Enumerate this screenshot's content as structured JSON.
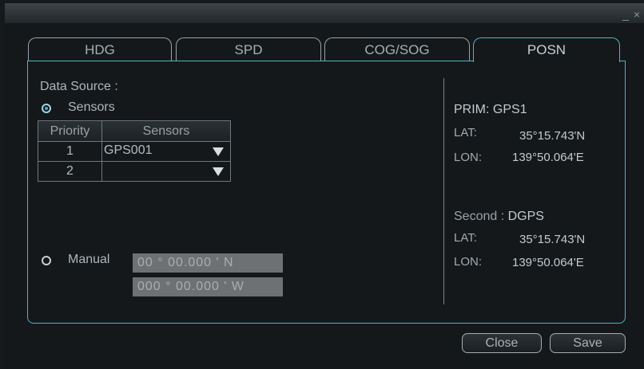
{
  "window": {
    "controls": "_ ×"
  },
  "tabs": [
    {
      "label": "HDG",
      "active": false
    },
    {
      "label": "SPD",
      "active": false
    },
    {
      "label": "COG/SOG",
      "active": false
    },
    {
      "label": "POSN",
      "active": true
    }
  ],
  "left": {
    "data_source_label": "Data Source :",
    "sensors_radio_label": "Sensors",
    "sensors_selected": true,
    "table": {
      "headers": [
        "Priority",
        "Sensors"
      ],
      "rows": [
        {
          "priority": "1",
          "sensor": "GPS001"
        },
        {
          "priority": "2",
          "sensor": ""
        }
      ]
    },
    "manual_radio_label": "Manual",
    "manual_lat": "00 ° 00.000 ' N",
    "manual_lon": "000 ° 00.000 ' W"
  },
  "right": {
    "prim": {
      "label": "PRIM:",
      "value": "GPS1",
      "lat_label": "LAT:",
      "lat": "35°15.743'N",
      "lon_label": "LON:",
      "lon": "139°50.064'E"
    },
    "second": {
      "label": "Second :",
      "value": "DGPS",
      "lat_label": "LAT:",
      "lat": "35°15.743'N",
      "lon_label": "LON:",
      "lon": "139°50.064'E"
    }
  },
  "buttons": {
    "close": "Close",
    "save": "Save"
  },
  "colors": {
    "accent": "#4fb3c4",
    "background": "#14181b"
  }
}
